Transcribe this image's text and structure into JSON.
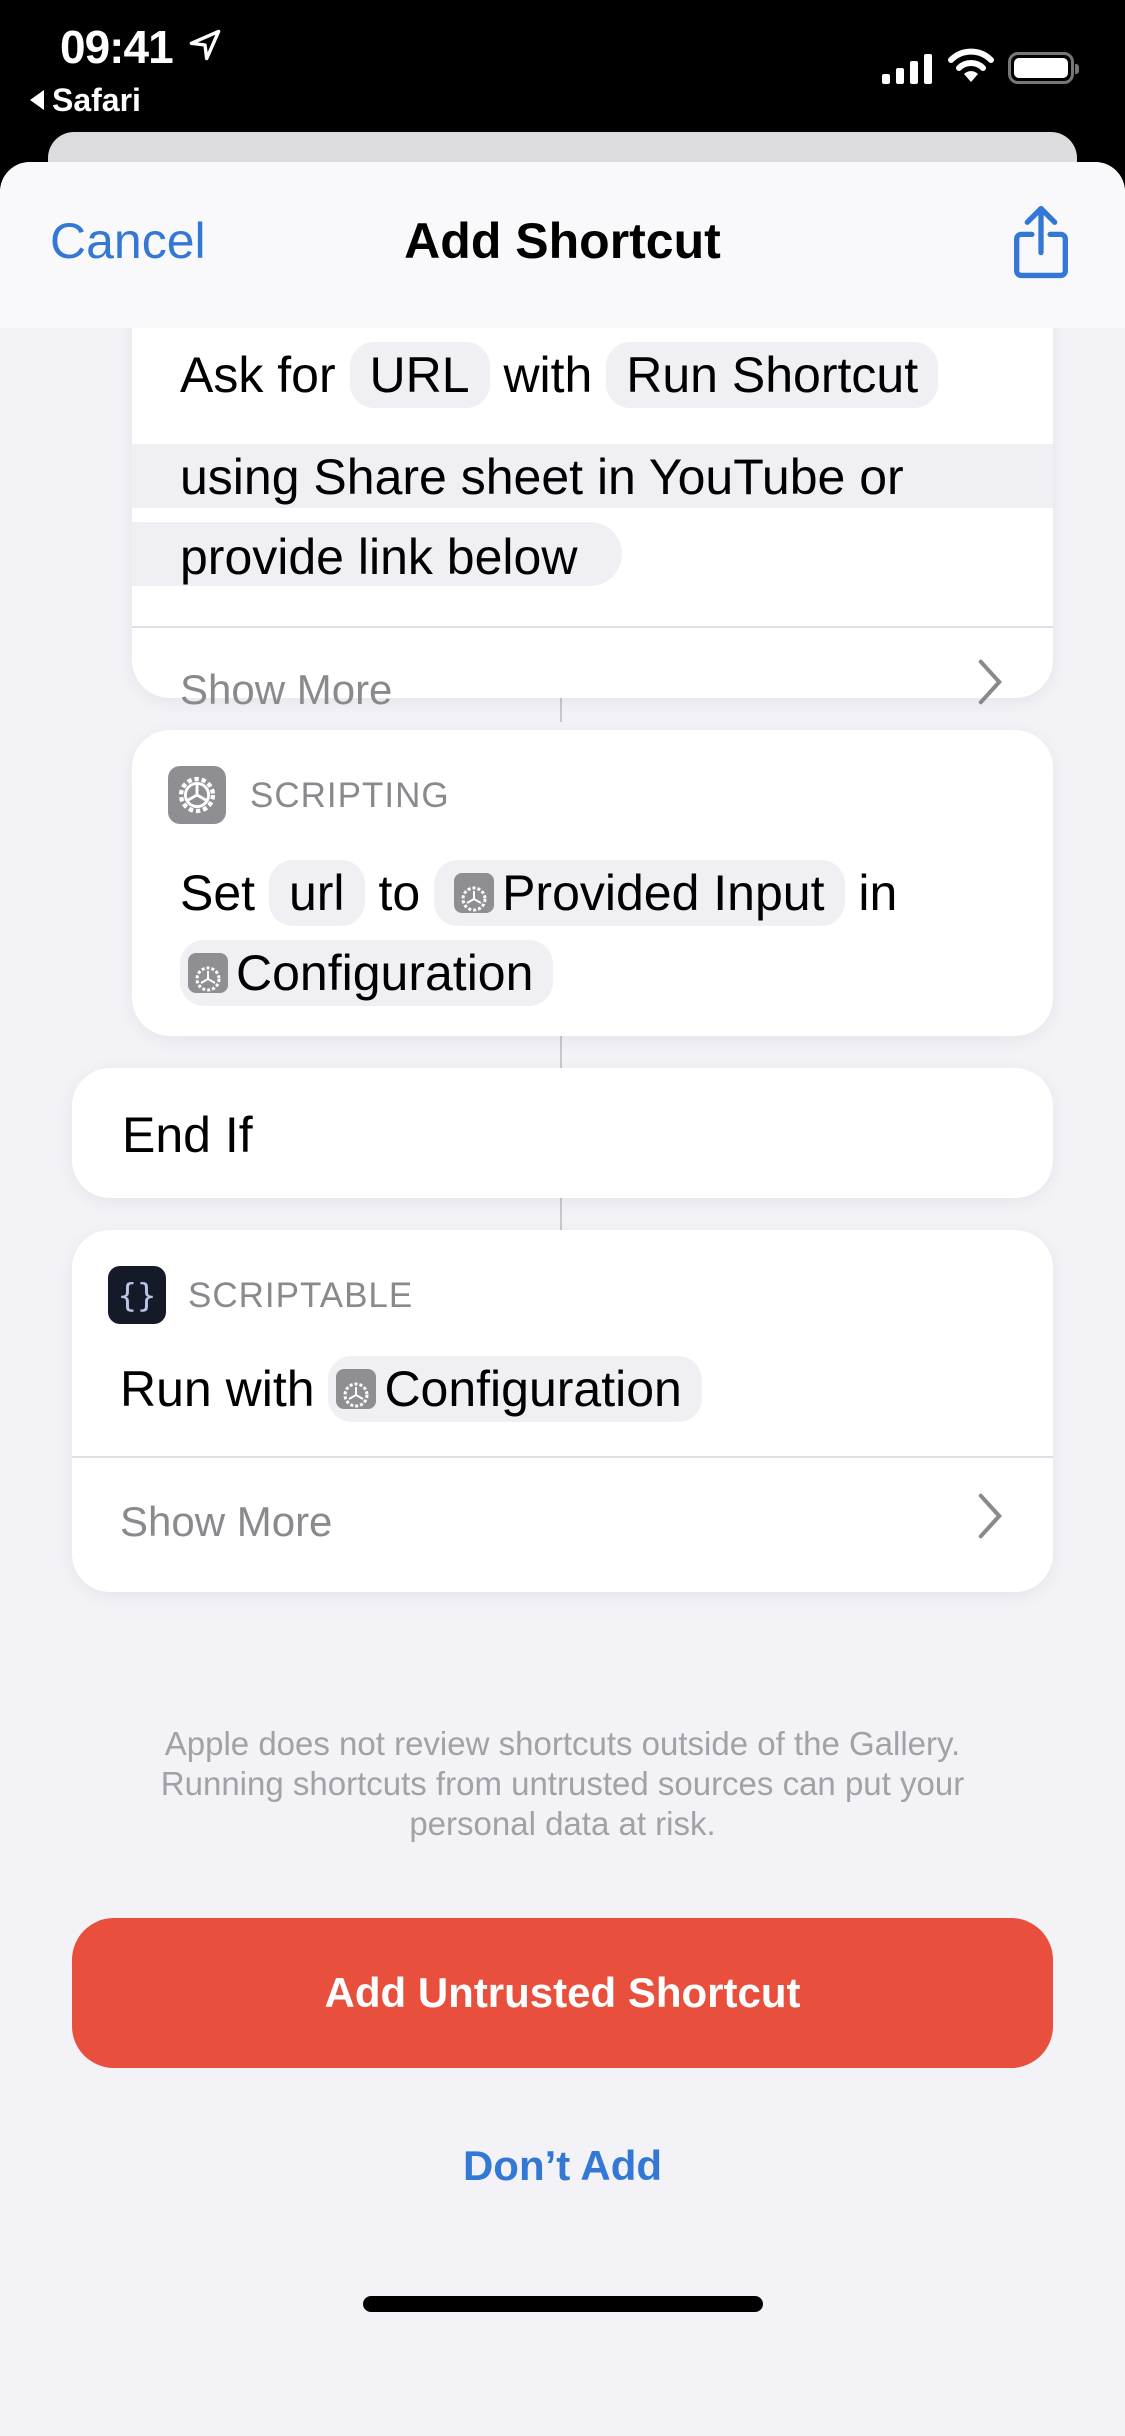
{
  "status_bar": {
    "time": "09:41",
    "back_app": "Safari",
    "icons": [
      "location-arrow-icon",
      "cellular-signal-icon",
      "wifi-icon",
      "battery-icon"
    ]
  },
  "nav": {
    "cancel_label": "Cancel",
    "title": "Add Shortcut",
    "share_icon": "share-icon"
  },
  "actions": [
    {
      "lines": [
        "Ask for",
        "URL",
        "with",
        "Run Shortcut",
        "using Share sheet in YouTube or",
        "provide link below"
      ],
      "show_more": "Show More"
    },
    {
      "app": "SCRIPTING",
      "parts": {
        "verb": "Set",
        "var": "url",
        "to": "to",
        "value": "Provided Input",
        "in": "in",
        "target": "Configuration"
      }
    },
    {
      "label": "End If"
    },
    {
      "app": "SCRIPTABLE",
      "parts": {
        "verb": "Run with",
        "value": "Configuration"
      },
      "show_more": "Show More"
    }
  ],
  "disclaimer": "Apple does not review shortcuts outside of the Gallery. Running shortcuts from untrusted sources can put your personal data at risk.",
  "buttons": {
    "add_untrusted": "Add Untrusted Shortcut",
    "dont_add": "Don’t Add"
  },
  "colors": {
    "accent": "#3478d6",
    "danger": "#e84f3d",
    "background": "#f2f2f7"
  }
}
